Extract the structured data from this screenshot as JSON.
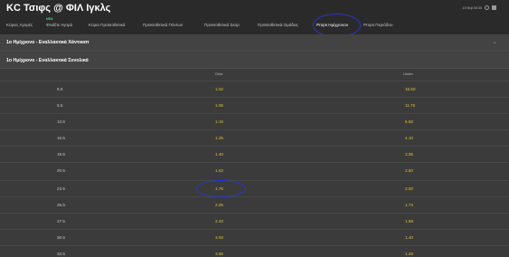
{
  "match": {
    "title": "ΚC Τσιφς @ ΦΙΛ Ιγκλς"
  },
  "header": {
    "datetime": "13 Φεβ 00:30"
  },
  "tabs": [
    {
      "label": "Κύριες Αγορές"
    },
    {
      "label": "Φτιάξτε Αγορά",
      "badge": "ΝΕΑ"
    },
    {
      "label": "Κύρια Προϊσοθετικά"
    },
    {
      "label": "Προϊσοθετικά Πόντων"
    },
    {
      "label": "Προϊσοθετικά Σκορ"
    },
    {
      "label": "Προϊσοθετικά Ομάδας"
    },
    {
      "label": "Props Ημίχρονου",
      "active": true
    },
    {
      "label": "Props Περιόδου"
    }
  ],
  "sections": {
    "handicap": {
      "title": "1ο Ημίχρονο - Εναλλακτικά Χάντικαπ"
    },
    "totals": {
      "title": "1ο Ημίχρονο - Εναλλακτικά Συνολικά"
    }
  },
  "columns": {
    "over": "Over",
    "under": "Under"
  },
  "rows": [
    {
      "line": "6.5",
      "over": "1.02",
      "under": "16.50"
    },
    {
      "line": "9.5",
      "over": "1.05",
      "under": "11.75"
    },
    {
      "line": "13.5",
      "over": "1.15",
      "under": "5.50"
    },
    {
      "line": "16.5",
      "over": "1.25",
      "under": "4.10"
    },
    {
      "line": "19.5",
      "over": "1.40",
      "under": "3.05"
    },
    {
      "line": "20.5",
      "over": "1.52",
      "under": "2.60"
    },
    {
      "line": "23.5",
      "over": "1.76",
      "under": "2.00"
    },
    {
      "line": "26.5",
      "over": "2.05",
      "under": "1.74"
    },
    {
      "line": "27.5",
      "over": "2.40",
      "under": "1.58"
    },
    {
      "line": "30.5",
      "over": "3.00",
      "under": "1.40"
    },
    {
      "line": "33.5",
      "over": "3.65",
      "under": "1.28"
    }
  ],
  "colors": {
    "odds": "#e2c33a",
    "new_badge": "#2ee08a",
    "annotation": "#2a37c9"
  }
}
